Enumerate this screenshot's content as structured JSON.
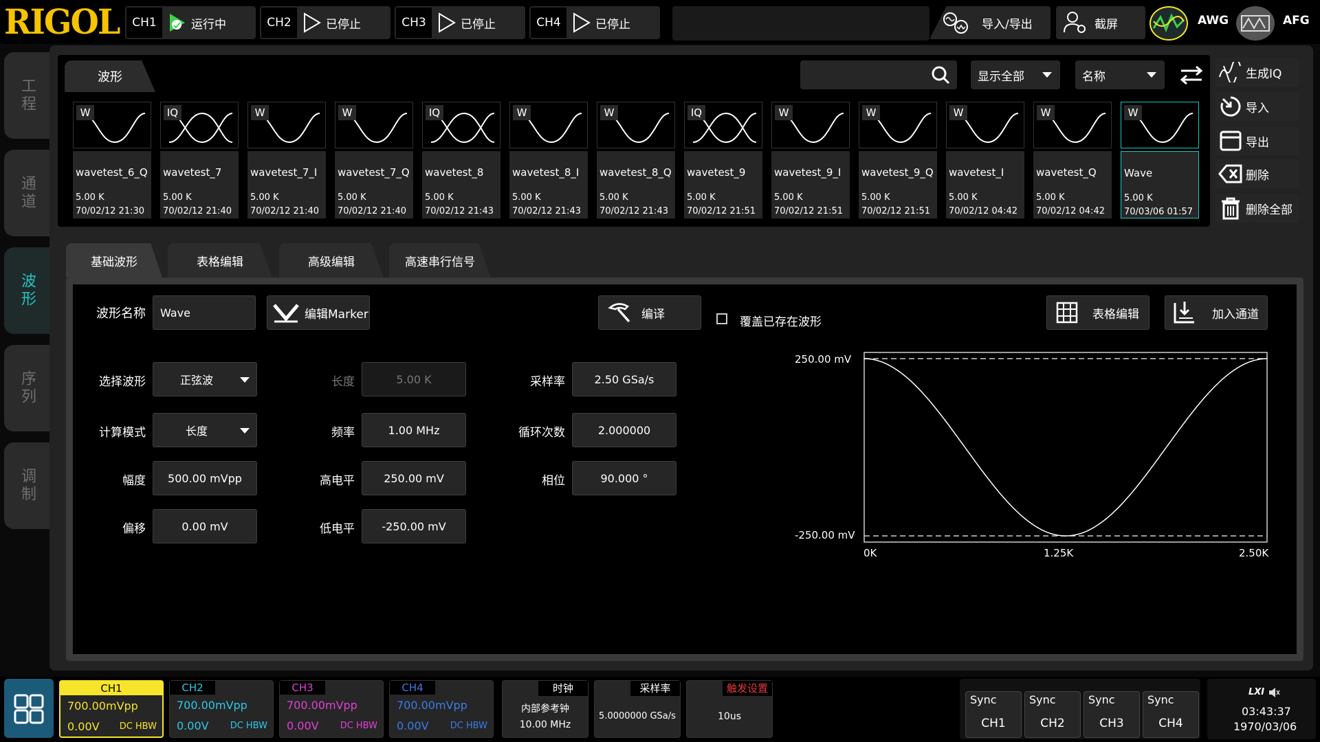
{
  "brand": "RIGOL",
  "channels_top": [
    {
      "label": "CH1",
      "status": "运行中",
      "color": "#3bd24a"
    },
    {
      "label": "CH2",
      "status": "已停止",
      "color": "#ffffff"
    },
    {
      "label": "CH3",
      "status": "已停止",
      "color": "#ffffff"
    },
    {
      "label": "CH4",
      "status": "已停止",
      "color": "#ffffff"
    }
  ],
  "top_actions": {
    "import_export": "导入/导出",
    "screenshot": "截屏",
    "awg": "AWG",
    "afg": "AFG"
  },
  "left_tabs": [
    "工程",
    "通道",
    "波形",
    "序列",
    "调制"
  ],
  "library": {
    "tab": "波形",
    "filter": "显示全部",
    "sort": "名称",
    "waveforms": [
      {
        "tag": "W",
        "name": "wavetest_6_Q",
        "size": "5.00 K",
        "date": "70/02/12 21:30"
      },
      {
        "tag": "IQ",
        "name": "wavetest_7",
        "size": "5.00 K",
        "date": "70/02/12 21:40"
      },
      {
        "tag": "W",
        "name": "wavetest_7_I",
        "size": "5.00 K",
        "date": "70/02/12 21:40"
      },
      {
        "tag": "W",
        "name": "wavetest_7_Q",
        "size": "5.00 K",
        "date": "70/02/12 21:40"
      },
      {
        "tag": "IQ",
        "name": "wavetest_8",
        "size": "5.00 K",
        "date": "70/02/12 21:43"
      },
      {
        "tag": "W",
        "name": "wavetest_8_I",
        "size": "5.00 K",
        "date": "70/02/12 21:43"
      },
      {
        "tag": "W",
        "name": "wavetest_8_Q",
        "size": "5.00 K",
        "date": "70/02/12 21:43"
      },
      {
        "tag": "IQ",
        "name": "wavetest_9",
        "size": "5.00 K",
        "date": "70/02/12 21:51"
      },
      {
        "tag": "W",
        "name": "wavetest_9_I",
        "size": "5.00 K",
        "date": "70/02/12 21:51"
      },
      {
        "tag": "W",
        "name": "wavetest_9_Q",
        "size": "5.00 K",
        "date": "70/02/12 21:51"
      },
      {
        "tag": "W",
        "name": "wavetest_I",
        "size": "5.00 K",
        "date": "70/02/12 04:42"
      },
      {
        "tag": "W",
        "name": "wavetest_Q",
        "size": "5.00 K",
        "date": "70/02/12 04:42"
      },
      {
        "tag": "W",
        "name": "Wave",
        "size": "5.00 K",
        "date": "70/03/06 01:57"
      }
    ],
    "actions": [
      "生成IQ",
      "导入",
      "导出",
      "删除",
      "删除全部"
    ]
  },
  "editor": {
    "tabs": [
      "基础波形",
      "表格编辑",
      "高级编辑",
      "高速串行信号"
    ],
    "name_label": "波形名称",
    "name_value": "Wave",
    "marker_btn": "编辑Marker",
    "compile_btn": "编译",
    "overwrite_label": "覆盖已存在波形",
    "table_edit_btn": "表格编辑",
    "add_channel_btn": "加入通道",
    "fields": {
      "wave_select": {
        "label": "选择波形",
        "value": "正弦波"
      },
      "calc_mode": {
        "label": "计算模式",
        "value": "长度"
      },
      "amplitude": {
        "label": "幅度",
        "value": "500.00 mVpp"
      },
      "offset": {
        "label": "偏移",
        "value": "0.00 mV"
      },
      "length": {
        "label": "长度",
        "value": "5.00 K"
      },
      "frequency": {
        "label": "频率",
        "value": "1.00 MHz"
      },
      "high_level": {
        "label": "高电平",
        "value": "250.00 mV"
      },
      "low_level": {
        "label": "低电平",
        "value": "-250.00 mV"
      },
      "sample_rate": {
        "label": "采样率",
        "value": "2.50 GSa/s"
      },
      "cycles": {
        "label": "循环次数",
        "value": "2.000000"
      },
      "phase": {
        "label": "相位",
        "value": "90.000 °"
      }
    },
    "preview": {
      "y_top": "250.00 mV",
      "y_bottom": "-250.00 mV",
      "x_ticks": [
        "0K",
        "1.25K",
        "2.50K"
      ]
    }
  },
  "chart_data": {
    "type": "line",
    "title": "",
    "xlabel": "",
    "ylabel": "",
    "x": [
      0,
      0.25,
      0.5,
      0.75,
      1.0,
      1.25,
      1.5,
      1.75,
      2.0,
      2.25,
      2.5
    ],
    "y": [
      250,
      202,
      77,
      -77,
      -202,
      -250,
      -202,
      -77,
      77,
      202,
      250
    ],
    "xlim": [
      0,
      2.5
    ],
    "ylim": [
      -250,
      250
    ]
  },
  "bottom": {
    "channels": [
      {
        "label": "CH1",
        "amp": "700.00mVpp",
        "offset": "0.00V",
        "coupling": "DC HBW",
        "color": "#f6e52a"
      },
      {
        "label": "CH2",
        "amp": "700.00mVpp",
        "offset": "0.00V",
        "coupling": "DC HBW",
        "color": "#2ec8e6"
      },
      {
        "label": "CH3",
        "amp": "700.00mVpp",
        "offset": "0.00V",
        "coupling": "DC HBW",
        "color": "#e23fd8"
      },
      {
        "label": "CH4",
        "amp": "700.00mVpp",
        "offset": "0.00V",
        "coupling": "DC HBW",
        "color": "#3a7be8"
      }
    ],
    "clock": {
      "title": "时钟",
      "line1": "内部参考钟",
      "line2": "10.00 MHz"
    },
    "samplerate": {
      "title": "采样率",
      "value": "5.0000000 GSa/s"
    },
    "trigger": {
      "title": "触发设置",
      "value": "10us"
    },
    "sync": [
      {
        "top": "Sync",
        "ch": "CH1"
      },
      {
        "top": "Sync",
        "ch": "CH2"
      },
      {
        "top": "Sync",
        "ch": "CH3"
      },
      {
        "top": "Sync",
        "ch": "CH4"
      }
    ],
    "lxi": "LXI",
    "time": "03:43:37",
    "date": "1970/03/06"
  }
}
